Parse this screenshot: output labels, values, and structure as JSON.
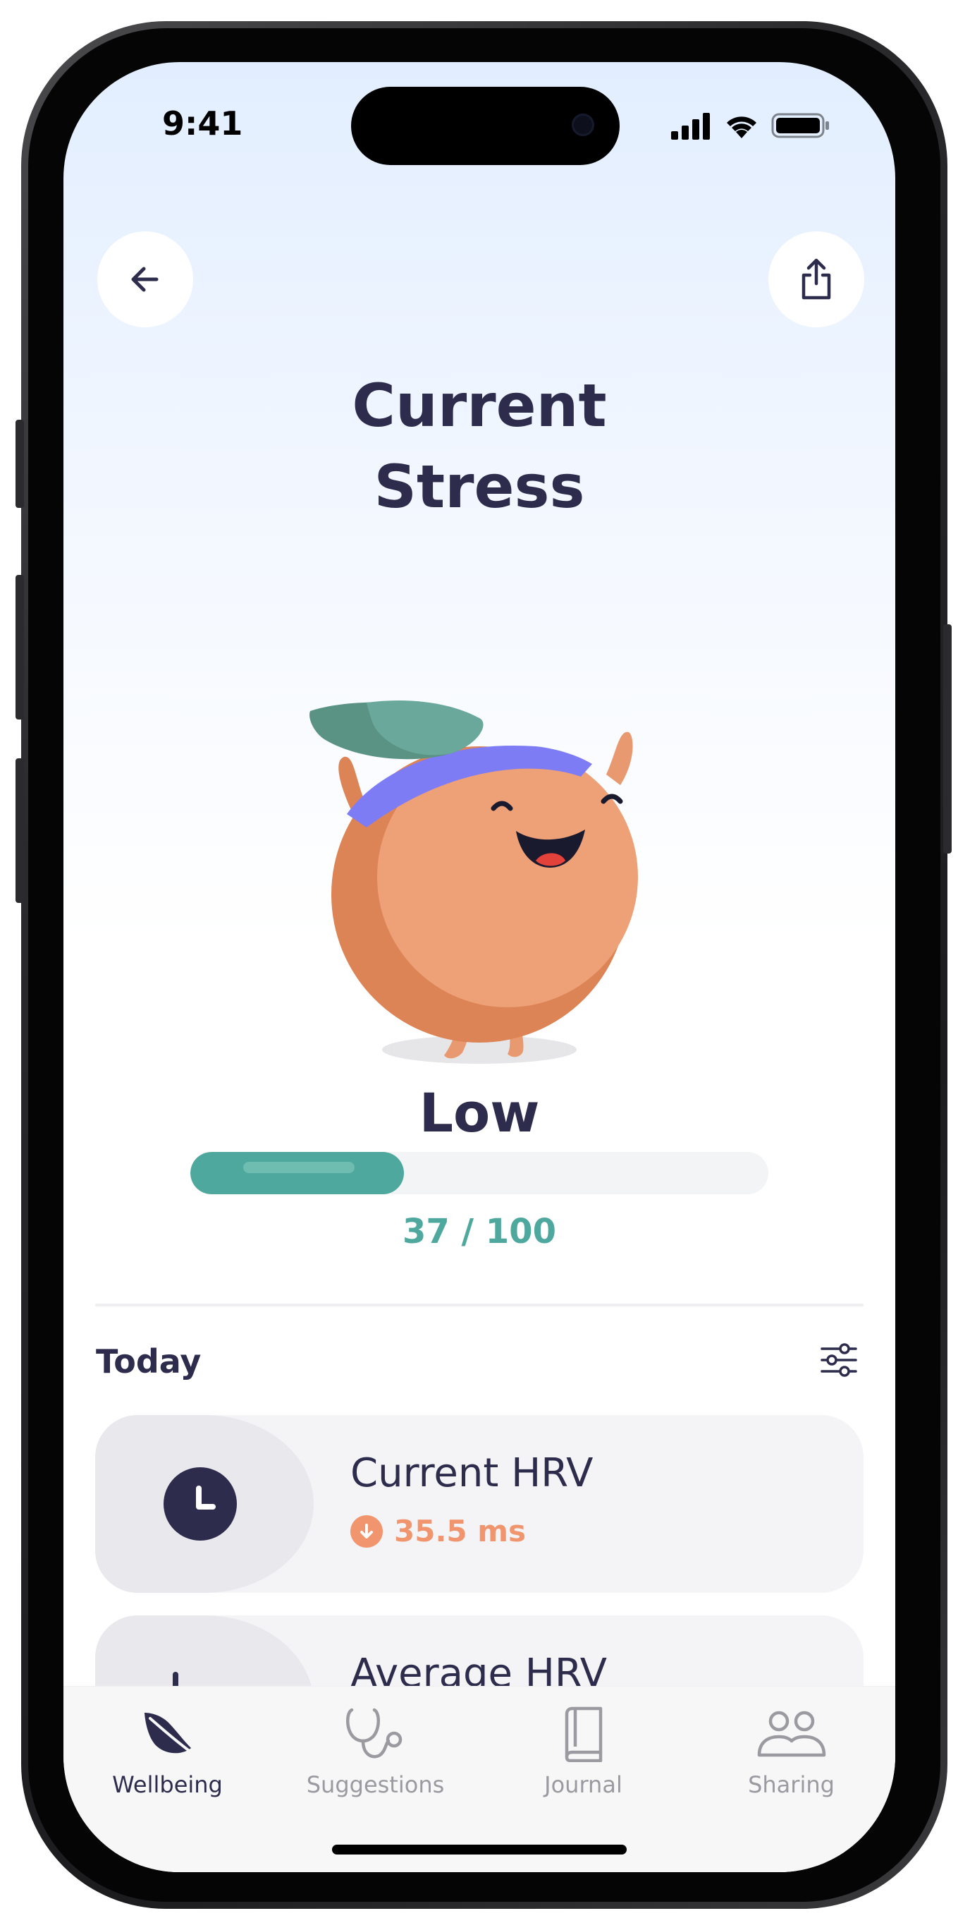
{
  "status_bar": {
    "time": "9:41"
  },
  "header": {
    "title": "Current\nStress"
  },
  "stress": {
    "level": "Low",
    "score_text": "37 / 100",
    "score": 37,
    "max": 100,
    "accent": "#4fa89e"
  },
  "today": {
    "title": "Today",
    "cards": [
      {
        "title": "Current HRV",
        "value": "35.5 ms",
        "trend": "down",
        "icon": "clock-icon"
      },
      {
        "title": "Average HRV",
        "icon": "chart-icon"
      }
    ]
  },
  "tabs": [
    {
      "label": "Wellbeing",
      "icon": "leaf-icon",
      "active": true
    },
    {
      "label": "Suggestions",
      "icon": "stethoscope-icon",
      "active": false
    },
    {
      "label": "Journal",
      "icon": "book-icon",
      "active": false
    },
    {
      "label": "Sharing",
      "icon": "people-icon",
      "active": false
    }
  ],
  "colors": {
    "text_dark": "#2e2c4d",
    "trend_down": "#f0956d",
    "tab_inactive": "#9a9aa0"
  }
}
